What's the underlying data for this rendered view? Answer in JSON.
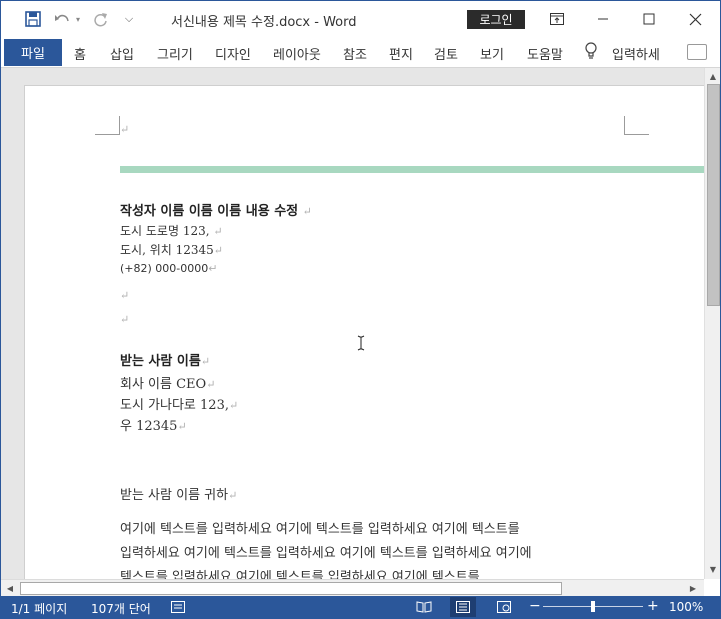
{
  "titlebar": {
    "qat_more": "⌵",
    "doc_title": "서신내용 제목 수정.docx -  Word",
    "login_label": "로그인"
  },
  "ribbon": {
    "file_tab": "파일",
    "tabs": [
      "홈",
      "삽입",
      "그리기",
      "디자인",
      "레이아웃",
      "참조",
      "편지",
      "검토",
      "보기",
      "도움말"
    ],
    "tell_me": "입력하세"
  },
  "document": {
    "sender_name": "작성자 이름 이름 이름 내용 수정",
    "sender_address1": "도시 도로명 123,",
    "sender_address2": "도시, 위치 12345",
    "sender_phone": "(+82) 000-0000",
    "recipient_heading": "받는 사람 이름",
    "recipient_company": "회사 이름 CEO",
    "recipient_address1": "도시 가나다로 123,",
    "recipient_postal": "우 12345",
    "salutation": "받는 사람 이름 귀하",
    "body_line1": "여기에 텍스트를 입력하세요 여기에 텍스트를 입력하세요 여기에 텍스트를",
    "body_line2": "입력하세요 여기에 텍스트를 입력하세요 여기에 텍스트를 입력하세요 여기에",
    "body_line3": "텍스트를 입력하세요 여기에 텍스트를 입력하세요 여기에 텍스트를",
    "pilcrow": "↵"
  },
  "statusbar": {
    "page_info": "1/1 페이지",
    "word_count": "107개 단어",
    "zoom_minus": "−",
    "zoom_plus": "+",
    "zoom_level": "100%"
  },
  "colors": {
    "brand_blue": "#2b579a",
    "accent_bar": "#a8d8c0"
  }
}
